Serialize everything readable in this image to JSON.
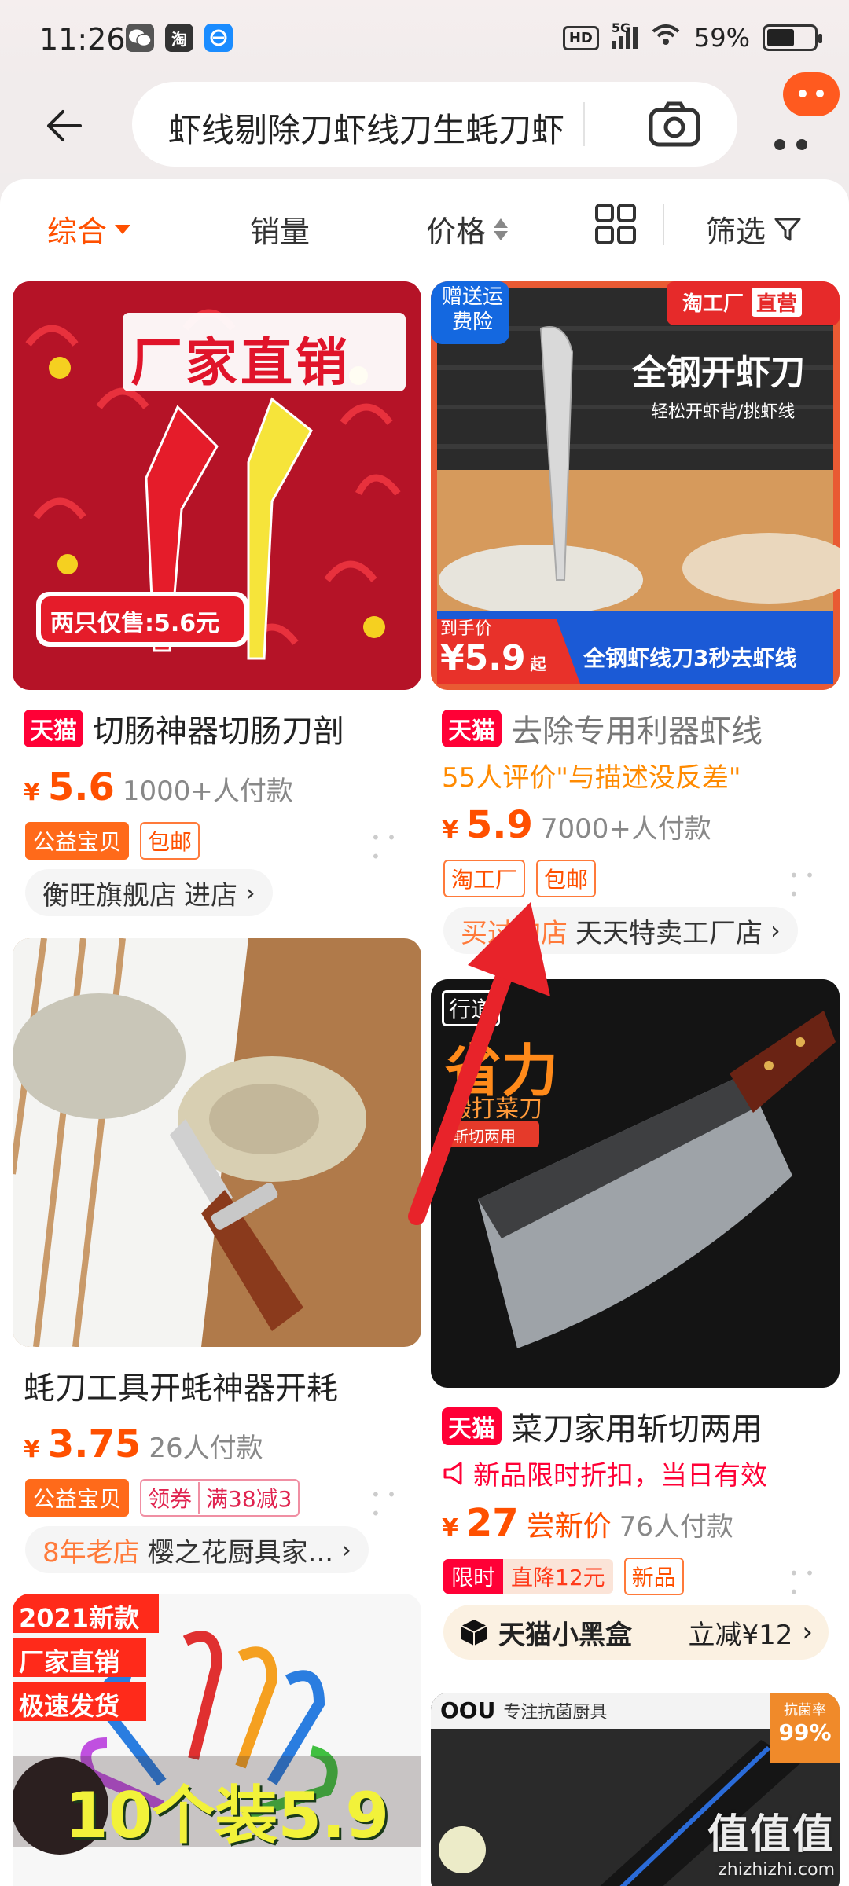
{
  "status_bar": {
    "time": "11:26",
    "network": "5G",
    "battery_percent": "59%",
    "battery_level": 0.59,
    "hd_label": "HD"
  },
  "header": {
    "search_text": "虾线剔除刀虾线刀生蚝刀虾"
  },
  "filter_bar": {
    "comprehensive": "综合",
    "sales": "销量",
    "price": "价格",
    "filter": "筛选"
  },
  "products": [
    {
      "title": "切肠神器切肠刀剖",
      "platform": "天猫",
      "price": "5.6",
      "sales": "1000+人付款",
      "tags": [
        "公益宝贝",
        "包邮"
      ],
      "shop_name": "衡旺旗舰店",
      "shop_action": "进店",
      "image_banner": "厂家直销",
      "image_price_badge": "两只仅售:5.6元"
    },
    {
      "title": "去除专用利器虾线",
      "platform": "天猫",
      "review": "55人评价\"与描述没反差\"",
      "price": "5.9",
      "sales": "7000+人付款",
      "tags": [
        "淘工厂",
        "包邮"
      ],
      "shop_prefix": "买过的店",
      "shop_name": "天天特卖工厂店",
      "image_badge_free": "赠送运费险",
      "image_brand": "淘工厂",
      "image_brand_sub": "直营",
      "image_headline": "全钢开虾刀",
      "image_sub": "轻松开虾背/挑虾线",
      "image_price_label": "到手价",
      "image_price": "¥5.9",
      "image_price_suffix": "起",
      "image_bottom": "全钢虾线刀3秒去虾线"
    },
    {
      "title": "蚝刀工具开蚝神器开耗",
      "price": "3.75",
      "sales": "26人付款",
      "tags": [
        "公益宝贝",
        "领券",
        "满38减3"
      ],
      "shop_prefix": "8年老店",
      "shop_name": "樱之花厨具家..."
    },
    {
      "title": "菜刀家用斩切两用",
      "platform": "天猫",
      "promo": "新品限时折扣，当日有效",
      "price": "27",
      "price_label": "尝新价",
      "sales": "76人付款",
      "tags": [
        "限时",
        "直降12元",
        "新品"
      ],
      "blackbox_label": "天猫小黑盒",
      "blackbox_offer": "立减¥12",
      "image_brand": "行道",
      "image_headline": "省力",
      "image_sub": "锻打菜刀",
      "image_tag": "斩切两用"
    },
    {
      "image_lines": [
        "2021新款",
        "厂家直销",
        "极速发货"
      ],
      "image_bottom": "10个装5.9"
    },
    {
      "image_brand": "OOU",
      "image_sub": "专注抗菌厨具",
      "image_badge_top": "抗菌率",
      "image_badge_value": "99%"
    }
  ],
  "watermark": {
    "big": "值值值",
    "small": "zhizhizhi.com"
  },
  "colors": {
    "accent": "#ff5000",
    "tmall": "#ff0036",
    "arrow": "#e8232a"
  }
}
